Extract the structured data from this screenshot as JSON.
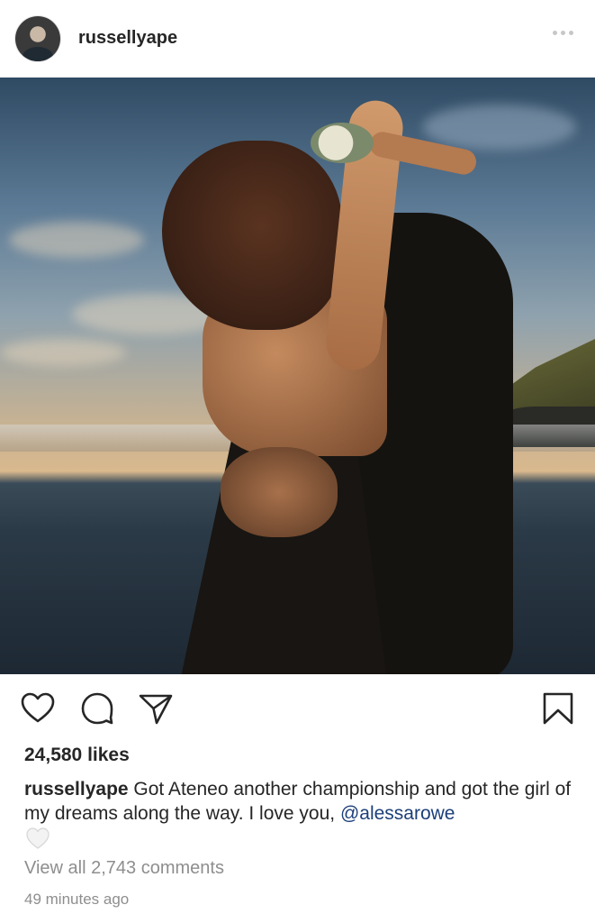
{
  "post": {
    "username": "russellyape",
    "likes_text": "24,580 likes",
    "caption_username": "russellyape",
    "caption_text": " Got Ateneo another championship and got the girl of my dreams along the way. I love you, ",
    "caption_mention": "@alessarowe",
    "view_comments": "View all 2,743 comments",
    "timestamp": "49 minutes ago"
  },
  "icons": {
    "header_more": "more-options-icon",
    "like": "heart-icon",
    "comment": "comment-icon",
    "share": "share-icon",
    "save": "bookmark-icon",
    "caption_emoji": "white-heart-icon"
  },
  "colors": {
    "text": "#262626",
    "muted": "#8e8e8e",
    "mention": "#1b3f79"
  }
}
